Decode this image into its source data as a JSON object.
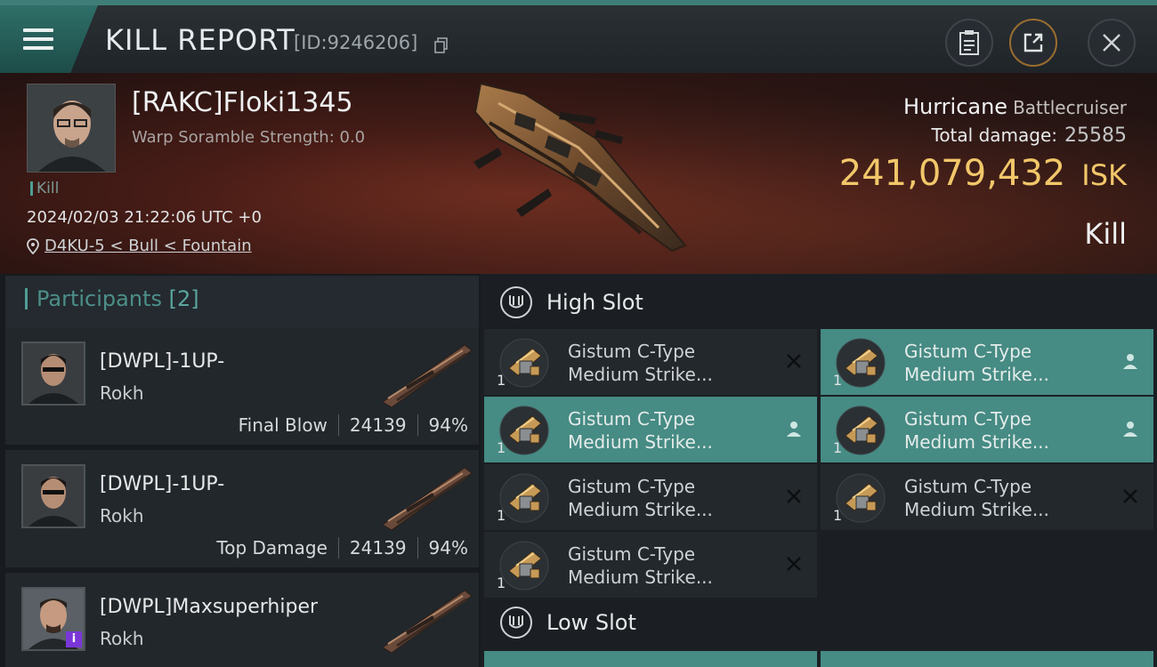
{
  "header": {
    "title": "KILL REPORT",
    "report_id": "[ID:9246206]",
    "icons": [
      "menu-icon",
      "copy-icon",
      "clipboard-icon",
      "share-icon",
      "close-icon"
    ]
  },
  "victim": {
    "pilot": "[RAKC]Floki1345",
    "warp_scramble": "Warp Soramble Strength: 0.0",
    "tag": "Kill",
    "datetime": "2024/02/03 21:22:06 UTC +0",
    "location": "D4KU-5 < Bull < Fountain",
    "ship_name": "Hurricane",
    "ship_class": "Battlecruiser",
    "total_damage_label": "Total damage:",
    "total_damage": "25585",
    "isk_value": "241,079,432",
    "isk_unit": "ISK",
    "result": "Kill"
  },
  "participants": {
    "label": "Participants",
    "count": "[2]",
    "items": [
      {
        "name": "[DWPL]-1UP-",
        "ship": "Rokh",
        "role": "Final Blow",
        "damage": "24139",
        "percent": "94%"
      },
      {
        "name": "[DWPL]-1UP-",
        "ship": "Rokh",
        "role": "Top Damage",
        "damage": "24139",
        "percent": "94%"
      },
      {
        "name": "[DWPL]Maxsuperhiper",
        "ship": "Rokh",
        "badge": "i"
      }
    ]
  },
  "slots": {
    "high_label": "High Slot",
    "low_label": "Low Slot",
    "high": [
      {
        "line1": "Gistum C-Type",
        "line2": "Medium Strike...",
        "qty": "1",
        "status": "destroyed"
      },
      {
        "line1": "Gistum C-Type",
        "line2": "Medium Strike...",
        "qty": "1",
        "status": "dropped"
      },
      {
        "line1": "Gistum C-Type",
        "line2": "Medium Strike...",
        "qty": "1",
        "status": "dropped"
      },
      {
        "line1": "Gistum C-Type",
        "line2": "Medium Strike...",
        "qty": "1",
        "status": "dropped"
      },
      {
        "line1": "Gistum C-Type",
        "line2": "Medium Strike...",
        "qty": "1",
        "status": "destroyed"
      },
      {
        "line1": "Gistum C-Type",
        "line2": "Medium Strike...",
        "qty": "1",
        "status": "destroyed"
      },
      {
        "line1": "Gistum C-Type",
        "line2": "Medium Strike...",
        "qty": "1",
        "status": "destroyed"
      }
    ]
  },
  "colors": {
    "accent": "#468b84",
    "isk": "#f2c76a",
    "hero": "#4a1d17"
  }
}
